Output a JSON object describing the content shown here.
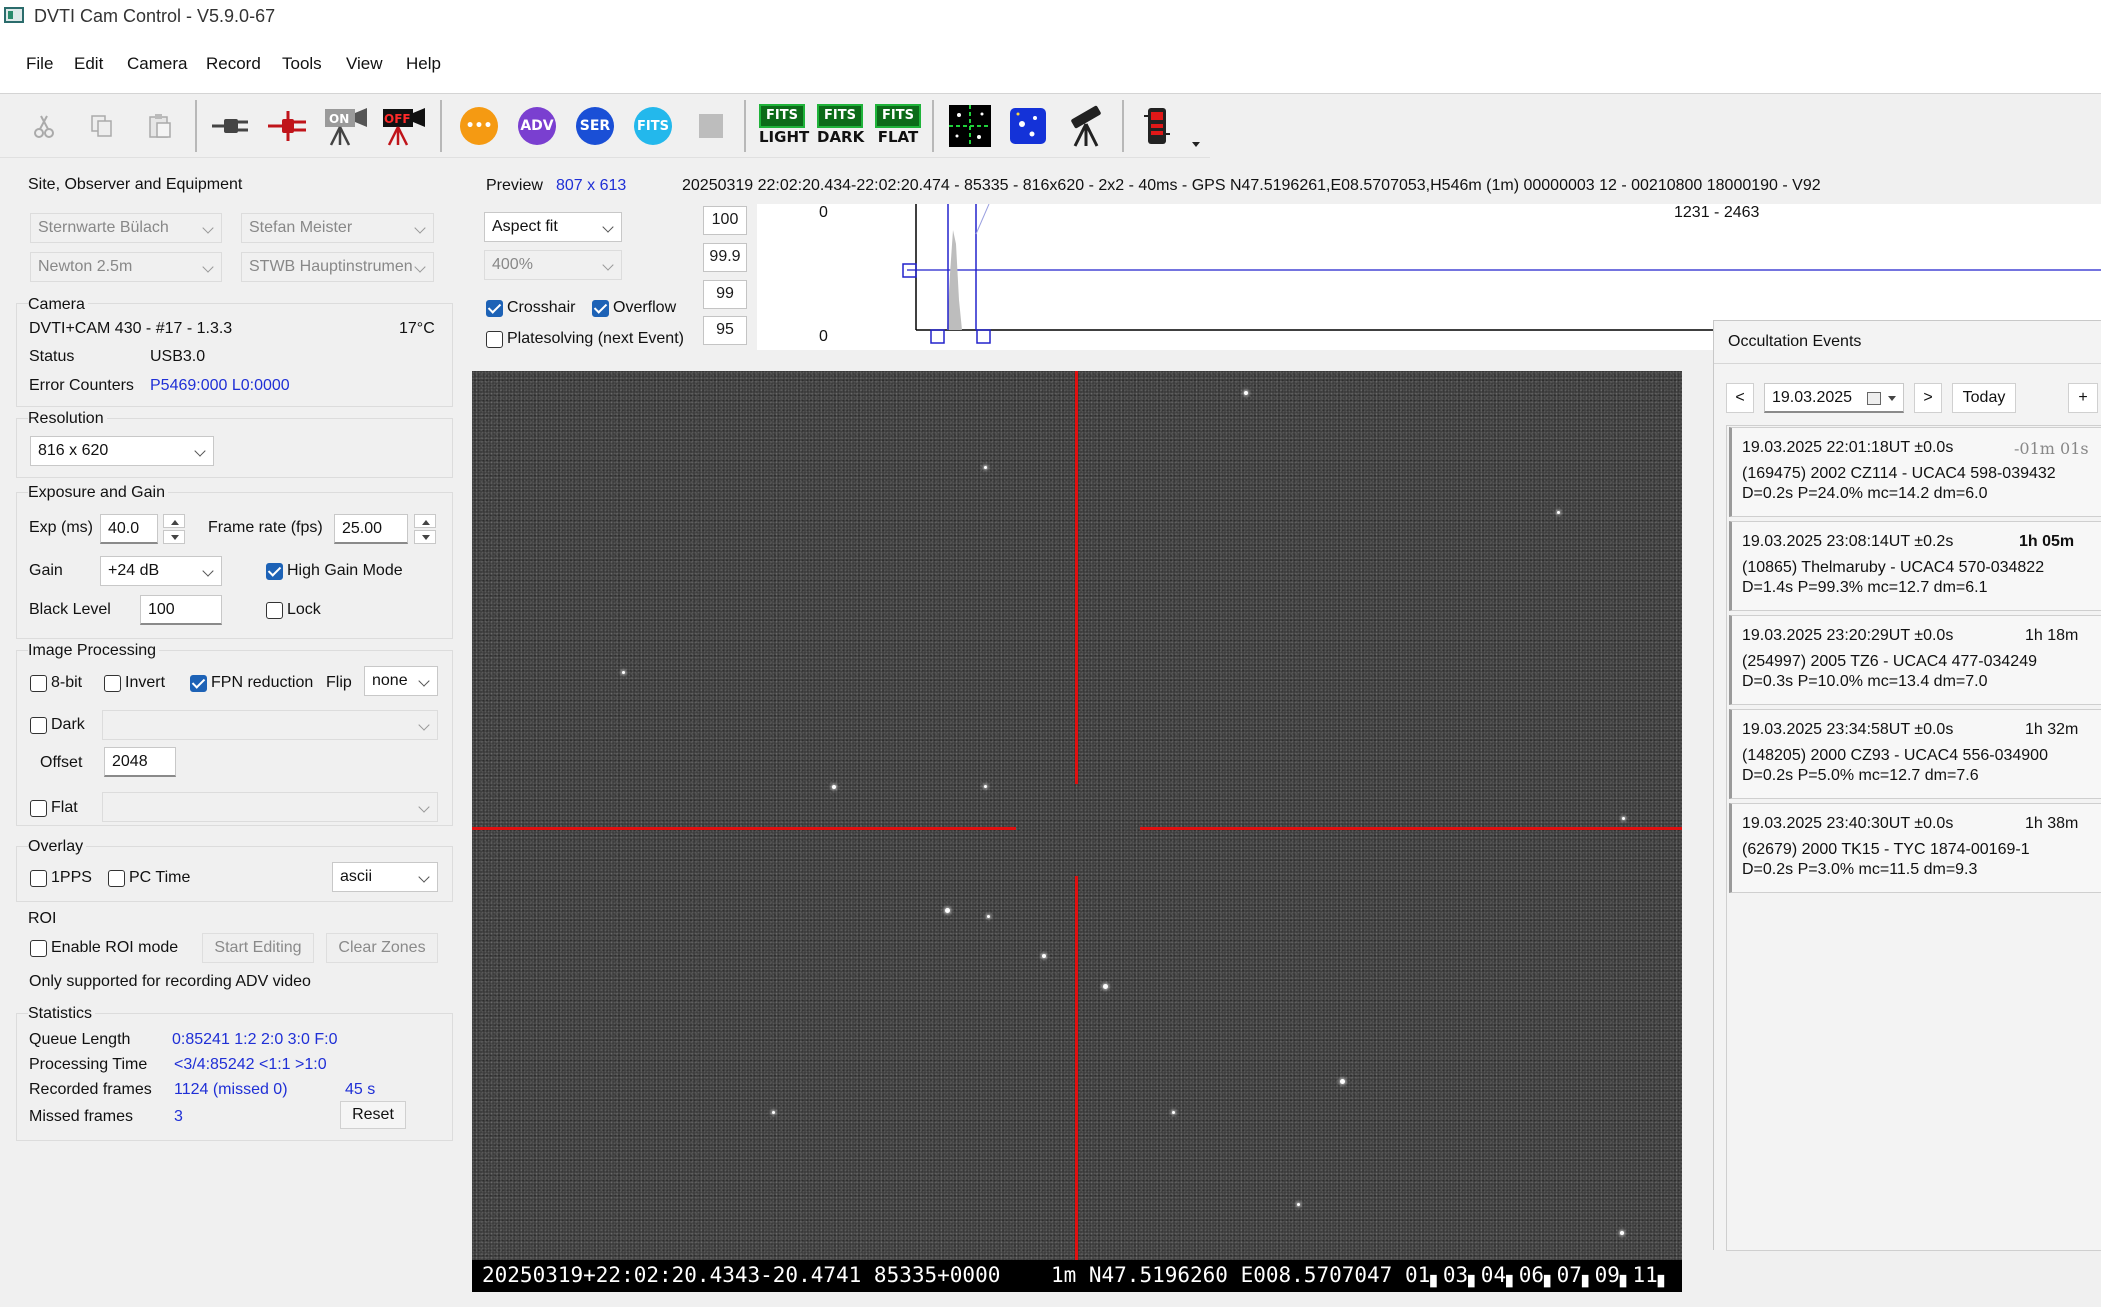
{
  "window": {
    "title": "DVTI Cam Control - V5.9.0-67"
  },
  "menu": [
    "File",
    "Edit",
    "Camera",
    "Record",
    "Tools",
    "View",
    "Help"
  ],
  "toolbar": {
    "round_buttons": [
      {
        "label": "•••",
        "color": "#f59a12"
      },
      {
        "label": "ADV",
        "color": "#7a3fd0"
      },
      {
        "label": "SER",
        "color": "#1a4fd6"
      },
      {
        "label": "FITS",
        "color": "#23b8ec"
      }
    ],
    "fits_buttons": [
      {
        "top": "FITS",
        "bottom": "LIGHT"
      },
      {
        "top": "FITS",
        "bottom": "DARK"
      },
      {
        "top": "FITS",
        "bottom": "FLAT"
      }
    ],
    "on_label": "ON",
    "off_label": "OFF"
  },
  "site": {
    "title": "Site, Observer and Equipment",
    "site": "Sternwarte Bülach",
    "observer": "Stefan Meister",
    "telescope": "Newton 2.5m",
    "instrument": "STWB Hauptinstrumen"
  },
  "camera": {
    "title": "Camera",
    "model": "DVTI+CAM 430  -  #17  -  1.3.3",
    "temp": "17°C",
    "status_label": "Status",
    "status": "USB3.0",
    "errors_label": "Error Counters",
    "errors": "P5469:000 L0:0000"
  },
  "resolution": {
    "title": "Resolution",
    "value": "816 x 620"
  },
  "exposure": {
    "title": "Exposure and Gain",
    "exp_label": "Exp (ms)",
    "exp": "40.0",
    "fps_label": "Frame rate (fps)",
    "fps": "25.00",
    "gain_label": "Gain",
    "gain": "+24 dB",
    "high_gain": "High Gain Mode",
    "black_label": "Black Level",
    "black": "100",
    "lock": "Lock"
  },
  "processing": {
    "title": "Image Processing",
    "bit8": "8-bit",
    "invert": "Invert",
    "fpn": "FPN reduction",
    "flip_label": "Flip",
    "flip": "none",
    "dark": "Dark",
    "offset_label": "Offset",
    "offset": "2048",
    "flat": "Flat"
  },
  "overlay": {
    "title": "Overlay",
    "pps": "1PPS",
    "pctime": "PC Time",
    "mode": "ascii"
  },
  "roi": {
    "title": "ROI",
    "enable": "Enable ROI mode",
    "start": "Start Editing",
    "clear": "Clear Zones",
    "note": "Only supported for recording ADV video"
  },
  "stats": {
    "title": "Statistics",
    "queue_label": "Queue Length",
    "queue": "0:85241  1:2  2:0  3:0  F:0",
    "proc_label": "Processing Time",
    "proc": "<3/4:85242 <1:1  >1:0",
    "rec_label": "Recorded frames",
    "rec": "1124 (missed 0)",
    "rec_time": "45 s",
    "missed_label": "Missed frames",
    "missed": "3",
    "reset": "Reset"
  },
  "preview": {
    "label": "Preview",
    "size": "807 x 613",
    "info": "20250319 22:02:20.434-22:02:20.474 - 85335 - 816x620 - 2x2 - 40ms - GPS N47.5196261,E08.5707053,H546m (1m) 00000003 12 - 00210800 18000190 - V92",
    "fit": "Aspect fit",
    "zoom": "400%",
    "crosshair": "Crosshair",
    "overflow": "Overflow",
    "platesolving": "Platesolving (next Event)",
    "levels": [
      "100",
      "99.9",
      "99",
      "95"
    ],
    "hist_zero_top": "0",
    "hist_zero_bottom": "0",
    "hist_range": "1231 - 2463"
  },
  "image": {
    "timestamp": "20250319+22:02:20.4343-20.4741 85335+0000    1m N47.5196260 E008.5707047 01▖03▖04▖06▖07▖09▖11▖"
  },
  "occultation": {
    "title": "Occultation Events",
    "prev": "<",
    "date": "19.03.2025",
    "next": ">",
    "today": "Today",
    "add": "+",
    "events": [
      {
        "time": "19.03.2025 22:01:18UT ±0.0s",
        "delta": "-01m 01s",
        "object": "(169475) 2002 CZ114 - UCAC4 598-039432",
        "params": "D=0.2s   P=24.0%   mc=14.2   dm=6.0"
      },
      {
        "time": "19.03.2025 23:08:14UT ±0.2s",
        "delta": "1h 05m",
        "object": "(10865) Thelmaruby - UCAC4 570-034822",
        "params": "D=1.4s   P=99.3%   mc=12.7   dm=6.1"
      },
      {
        "time": "19.03.2025 23:20:29UT ±0.0s",
        "delta": "1h 18m",
        "object": "(254997) 2005 TZ6 - UCAC4 477-034249",
        "params": "D=0.3s   P=10.0%   mc=13.4   dm=7.0"
      },
      {
        "time": "19.03.2025 23:34:58UT ±0.0s",
        "delta": "1h 32m",
        "object": "(148205) 2000 CZ93 - UCAC4 556-034900",
        "params": "D=0.2s   P=5.0%   mc=12.7   dm=7.6"
      },
      {
        "time": "19.03.2025 23:40:30UT ±0.0s",
        "delta": "1h 38m",
        "object": "(62679) 2000 TK15 - TYC 1874-00169-1",
        "params": "D=0.2s   P=3.0%   mc=11.5   dm=9.3"
      }
    ]
  }
}
